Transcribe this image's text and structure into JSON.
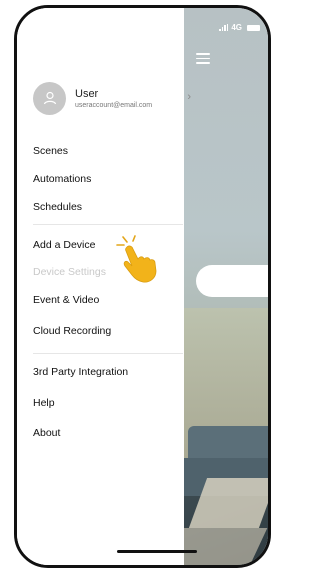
{
  "status": {
    "network": "4G"
  },
  "profile": {
    "name": "User",
    "email": "useraccount@email.com"
  },
  "menu": {
    "scenes": "Scenes",
    "automations": "Automations",
    "schedules": "Schedules",
    "add_device": "Add a Device",
    "device_settings": "Device Settings",
    "event_video": "Event & Video",
    "cloud_recording": "Cloud Recording",
    "third_party": "3rd Party Integration",
    "help": "Help",
    "about": "About"
  }
}
